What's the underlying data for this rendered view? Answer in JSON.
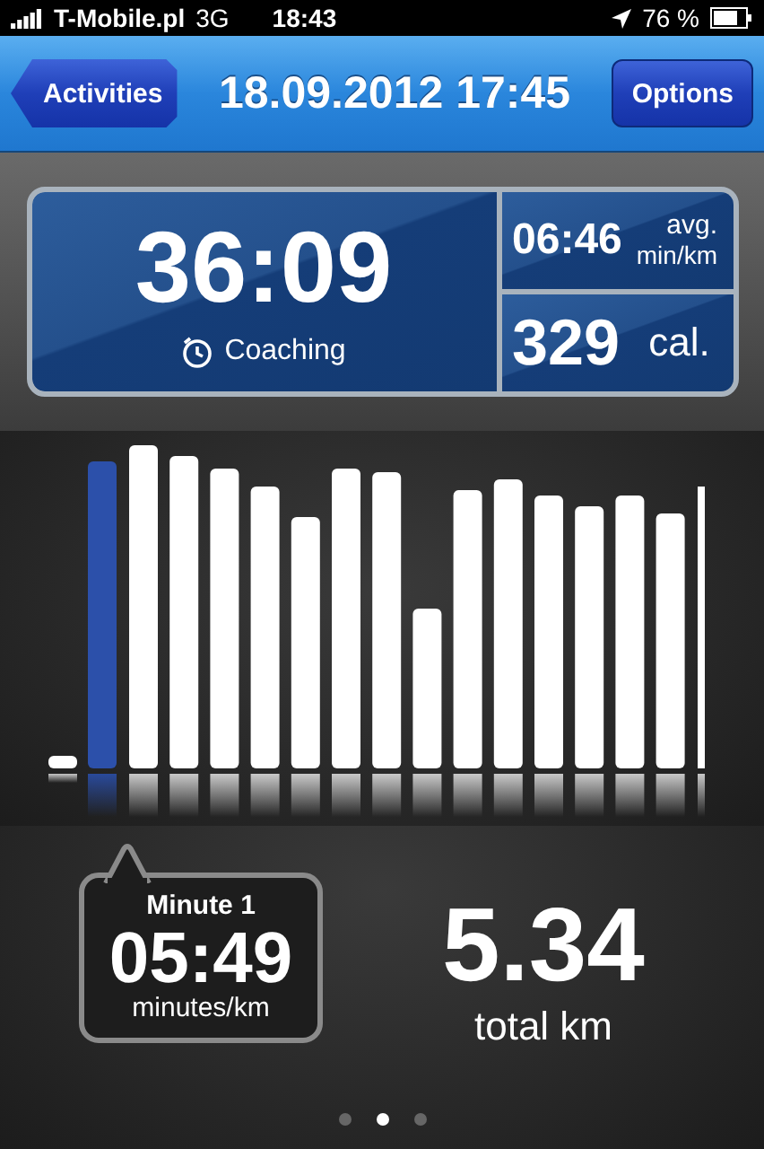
{
  "status_bar": {
    "carrier": "T-Mobile.pl",
    "network": "3G",
    "time": "18:43",
    "battery": "76 %"
  },
  "nav_bar": {
    "back": "Activities",
    "title": "18.09.2012 17:45",
    "action": "Options"
  },
  "summary": {
    "duration": "36:09",
    "coaching": "Coaching",
    "pace": "06:46",
    "pace_unit_top": "avg.",
    "pace_unit_bottom": "min/km",
    "calories": "329",
    "calories_unit": "cal."
  },
  "split": {
    "label": "Minute 1",
    "pace": "05:49",
    "unit": "minutes/km"
  },
  "distance": {
    "value": "5.34",
    "unit": "total km"
  },
  "pages": [
    {
      "selected": false
    },
    {
      "selected": true
    },
    {
      "selected": false
    }
  ]
}
